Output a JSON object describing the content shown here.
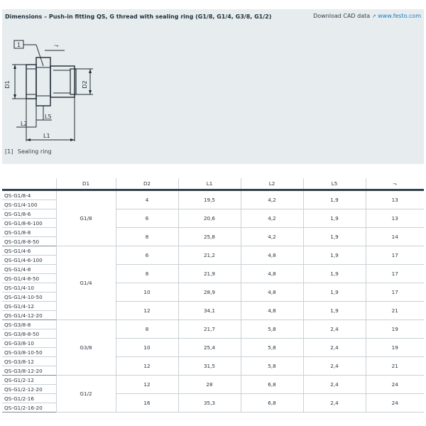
{
  "header": {
    "title": "Dimensions – Push-in fitting QS, G thread with sealing ring (G1/8, G1/4, G3/8, G1/2)",
    "cad_label": "Download CAD data",
    "cad_link": "www.festo.com",
    "cad_icon": "external-link-icon"
  },
  "drawing": {
    "callout": "1",
    "labels": {
      "d1": "D1",
      "d2": "D2",
      "l1": "L1",
      "l2": "L2",
      "l5": "L5"
    },
    "wrench_icon": "wrench-size-symbol"
  },
  "footnote": {
    "marker": "[1]",
    "text": "Sealing ring"
  },
  "table": {
    "headers": [
      "",
      "D1",
      "D2",
      "L1",
      "L2",
      "L5",
      "wrench-size-symbol"
    ],
    "header_symbol": "⤳",
    "rows": [
      {
        "parts": [
          "QS-G1/8-4",
          "QS-G1/4-100"
        ],
        "d1": "G1/8",
        "d2": "4",
        "l1": "19,5",
        "l2": "4,2",
        "l5": "1,9",
        "w": "13"
      },
      {
        "parts": [
          "QS-G1/8-6",
          "QS-G1/8-6-100"
        ],
        "d1": "G1/8",
        "d2": "6",
        "l1": "20,6",
        "l2": "4,2",
        "l5": "1,9",
        "w": "13"
      },
      {
        "parts": [
          "QS-G1/8-8",
          "QS-G1/8-8-50"
        ],
        "d1": "G1/8",
        "d2": "8",
        "l1": "25,8",
        "l2": "4,2",
        "l5": "1,9",
        "w": "14"
      },
      {
        "parts": [
          "QS-G1/4-6",
          "QS-G1/4-6-100"
        ],
        "d1": "G1/4",
        "d2": "6",
        "l1": "21,2",
        "l2": "4,8",
        "l5": "1,9",
        "w": "17"
      },
      {
        "parts": [
          "QS-G1/4-8",
          "QS-G1/4-8-50"
        ],
        "d1": "G1/4",
        "d2": "8",
        "l1": "21,9",
        "l2": "4,8",
        "l5": "1,9",
        "w": "17"
      },
      {
        "parts": [
          "QS-G1/4-10",
          "QS-G1/4-10-50"
        ],
        "d1": "G1/4",
        "d2": "10",
        "l1": "28,9",
        "l2": "4,8",
        "l5": "1,9",
        "w": "17"
      },
      {
        "parts": [
          "QS-G1/4-12",
          "QS-G1/4-12-20"
        ],
        "d1": "G1/4",
        "d2": "12",
        "l1": "34,1",
        "l2": "4,8",
        "l5": "1,9",
        "w": "21"
      },
      {
        "parts": [
          "QS-G3/8-8",
          "QS-G3/8-8-50"
        ],
        "d1": "G3/8",
        "d2": "8",
        "l1": "21,7",
        "l2": "5,8",
        "l5": "2,4",
        "w": "19"
      },
      {
        "parts": [
          "QS-G3/8-10",
          "QS-G3/8-10-50"
        ],
        "d1": "G3/8",
        "d2": "10",
        "l1": "25,4",
        "l2": "5,8",
        "l5": "2,4",
        "w": "19"
      },
      {
        "parts": [
          "QS-G3/8-12",
          "QS-G3/8-12-20"
        ],
        "d1": "G3/8",
        "d2": "12",
        "l1": "31,5",
        "l2": "5,8",
        "l5": "2,4",
        "w": "21"
      },
      {
        "parts": [
          "QS-G1/2-12",
          "QS-G1/2-12-20"
        ],
        "d1": "G1/2",
        "d2": "12",
        "l1": "28",
        "l2": "6,8",
        "l5": "2,4",
        "w": "24"
      },
      {
        "parts": [
          "QS-G1/2-16",
          "QS-G1/2-16-20"
        ],
        "d1": "G1/2",
        "d2": "16",
        "l1": "35,3",
        "l2": "6,8",
        "l5": "2,4",
        "w": "24"
      }
    ]
  }
}
